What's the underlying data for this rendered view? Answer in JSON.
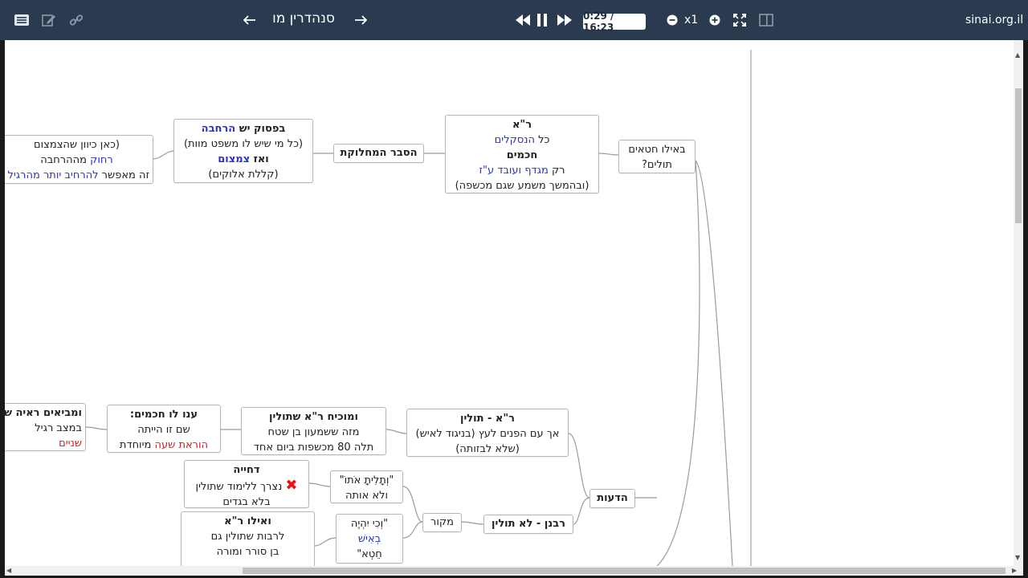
{
  "toolbar": {
    "title": "סנהדרין מו",
    "time": "0:29 / 16:23",
    "speed": "x1",
    "site": "sinai.org.il"
  },
  "nodes": {
    "eilu_hataim": [
      "באילו חטאים",
      "תולים?"
    ],
    "ra_top": {
      "l1": "ר\"א",
      "l2a": "כל ",
      "l2b": "הנסקלים",
      "l3": "חכמים",
      "l4a": "רק ",
      "l4b": "מגדף ועובד ע\"ז",
      "l5": "(ובהמשך משמע שגם מכשפה)"
    },
    "hesber": "הסבר המחלוקת",
    "bapasuk": {
      "l1a": "בפסוק יש ",
      "l1b": "הרחבה",
      "l2": "(כל מי שיש לו משפט מוות)",
      "l3a": "ואז ",
      "l3b": "צמצום",
      "l4": "(קללת אלוקים)"
    },
    "kan": {
      "l1": "(כאן כיוון שהצמצום",
      "l2a": "רחוק",
      "l2b": " מההרחבה",
      "l3a": "זה מאפשר ",
      "l3b": "להרחיב יותר מהרגיל"
    },
    "deot": "הדעות",
    "ra_tolin": {
      "l1": "ר\"א - תולין",
      "l2": "אך עם הפנים לעץ (בניגוד לאיש)",
      "l3": "(שלא לבזותה)"
    },
    "umochiach": {
      "l1": "ומוכיח ר\"א שתולין",
      "l2": "מזה ששמעון בן שטח",
      "l3": "תלה 80 מכשפות ביום אחד"
    },
    "anu": {
      "l1": "ענו לו חכמים:",
      "l2": "שם זו הייתה",
      "l3a": "הוראת שעה",
      "l3b": " מיוחדת"
    },
    "umeviim": {
      "l1": "ומביאים ראיה ש",
      "l2": "במצב רגיל",
      "l3": "שניים"
    },
    "rabanan": "רבנן - לא תולין",
    "makor": "מקור",
    "vetalita": [
      "\"וְתָלִיתָ אֹתוֹ\"",
      "ולא אותה"
    ],
    "dechiya": {
      "l1": "דחייה",
      "l2": "נצרך ללימוד שתולין",
      "l3": "בלא בגדים",
      "mark": "✖"
    },
    "vechi": {
      "l1": "\"וְכִי יִהְיֶה",
      "l2": "בְאִישׁ",
      "l3": "חֵטְא\""
    },
    "veilu": {
      "l1": "ואילו ר\"א",
      "l2": "לרבות שתולין גם",
      "l3": "בן סורר ומורה"
    }
  }
}
